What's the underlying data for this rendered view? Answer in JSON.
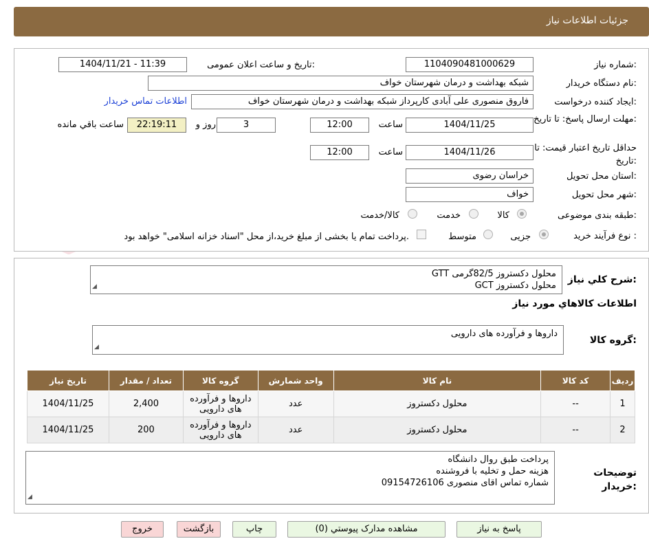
{
  "header": {
    "title": "جزئیات اطلاعات نیاز"
  },
  "form": {
    "need_number_label": "شماره نیاز:",
    "need_number": "1104090481000629",
    "announce_label": "تاریخ و ساعت اعلان عمومی:",
    "announce_value": "1404/11/21 - 11:39",
    "buyer_org_label": "نام دستگاه خریدار:",
    "buyer_org": "شبکه بهداشت و درمان شهرستان خواف",
    "creator_label": "ایجاد کننده درخواست:",
    "creator": "فاروق منصوری علی آبادی کارپرداز شبکه بهداشت و درمان شهرستان خواف",
    "buyer_contact_link": "اطلاعات تماس خریدار",
    "deadline_label": "مهلت ارسال پاسخ: تا تاریخ:",
    "deadline_date": "1404/11/25",
    "time_label": "ساعت",
    "deadline_time": "12:00",
    "days_value": "3",
    "days_label": "روز و",
    "remaining_time": "22:19:11",
    "remaining_label": "ساعت باقي مانده",
    "validity_label": "حداقل تاریخ اعتبار قیمت: تا تاریخ:",
    "validity_date": "1404/11/26",
    "validity_time": "12:00",
    "province_label": "استان محل تحویل:",
    "province": "خراسان رضوی",
    "city_label": "شهر محل تحویل:",
    "city": "خواف",
    "category_label": "طبقه بندی موضوعی:",
    "category_options": [
      "کالا",
      "خدمت",
      "کالا/خدمت"
    ],
    "process_label": "نوع فرآیند خرید :",
    "process_options": [
      "جزیی",
      "متوسط"
    ],
    "payment_note": "پرداخت تمام یا بخشی از مبلغ خرید،از محل \"اسناد خزانه اسلامی\" خواهد بود."
  },
  "summary": {
    "label": "شرح کلي نیاز:",
    "line1": "محلول دکستروز 82/5گرمی  GTT",
    "line2": "محلول دکستروز GCT",
    "items_title": "اطلاعات کالاهاي مورد نیاز",
    "group_label": "گروه کالا:",
    "group_value": "داروها و فرآورده های دارویی"
  },
  "table": {
    "headers": [
      "ردیف",
      "کد کالا",
      "نام کالا",
      "واحد شمارش",
      "گروه کالا",
      "تعداد / مقدار",
      "تاریخ نیاز"
    ],
    "rows": [
      [
        "1",
        "--",
        "محلول دکستروز",
        "عدد",
        "داروها و فرآورده های دارویی",
        "2,400",
        "1404/11/25"
      ],
      [
        "2",
        "--",
        "محلول دکستروز",
        "عدد",
        "داروها و فرآورده های دارویی",
        "200",
        "1404/11/25"
      ]
    ]
  },
  "notes": {
    "label": "توضیحات خریدار:",
    "line1": "پرداخت طبق روال دانشگاه",
    "line2": "هزینه حمل و تخلیه با فروشنده",
    "line3": "شماره تماس اقای منصوری 09154726106"
  },
  "buttons": {
    "reply": "پاسخ به نیاز",
    "docs": "مشاهده مدارک پیوستي (0)",
    "print": "چاپ",
    "back": "بازگشت",
    "exit": "خروج"
  },
  "watermark": {
    "text": "AriaTender.neT"
  },
  "colors": {
    "header_bg": "#8b6a41",
    "link": "#1a3fd6",
    "remaining_bg": "#f3f0c4",
    "btn_green": "#eaf7e2",
    "btn_red": "#f9d6d6"
  }
}
